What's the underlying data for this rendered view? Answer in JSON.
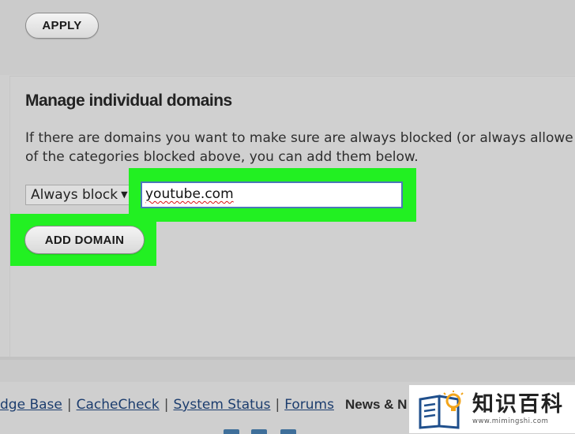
{
  "top": {
    "apply_label": "APPLY"
  },
  "panel": {
    "title": "Manage individual domains",
    "description_line1": "If there are domains you want to make sure are always blocked (or always allowe",
    "description_line2": "of the categories blocked above, you can add them below.",
    "select_value": "Always block",
    "domain_input_value": "youtube.com",
    "add_domain_label": "ADD DOMAIN"
  },
  "footer": {
    "links": [
      "dge Base",
      "CacheCheck",
      "System Status",
      "Forums"
    ],
    "separator": "|",
    "news_label": "News & N"
  },
  "watermark": {
    "title": "知识百科",
    "url": "www.mimingshi.com"
  },
  "colors": {
    "highlight": "#22f022",
    "link": "#1c3d6e",
    "background": "#cfcfcf"
  }
}
